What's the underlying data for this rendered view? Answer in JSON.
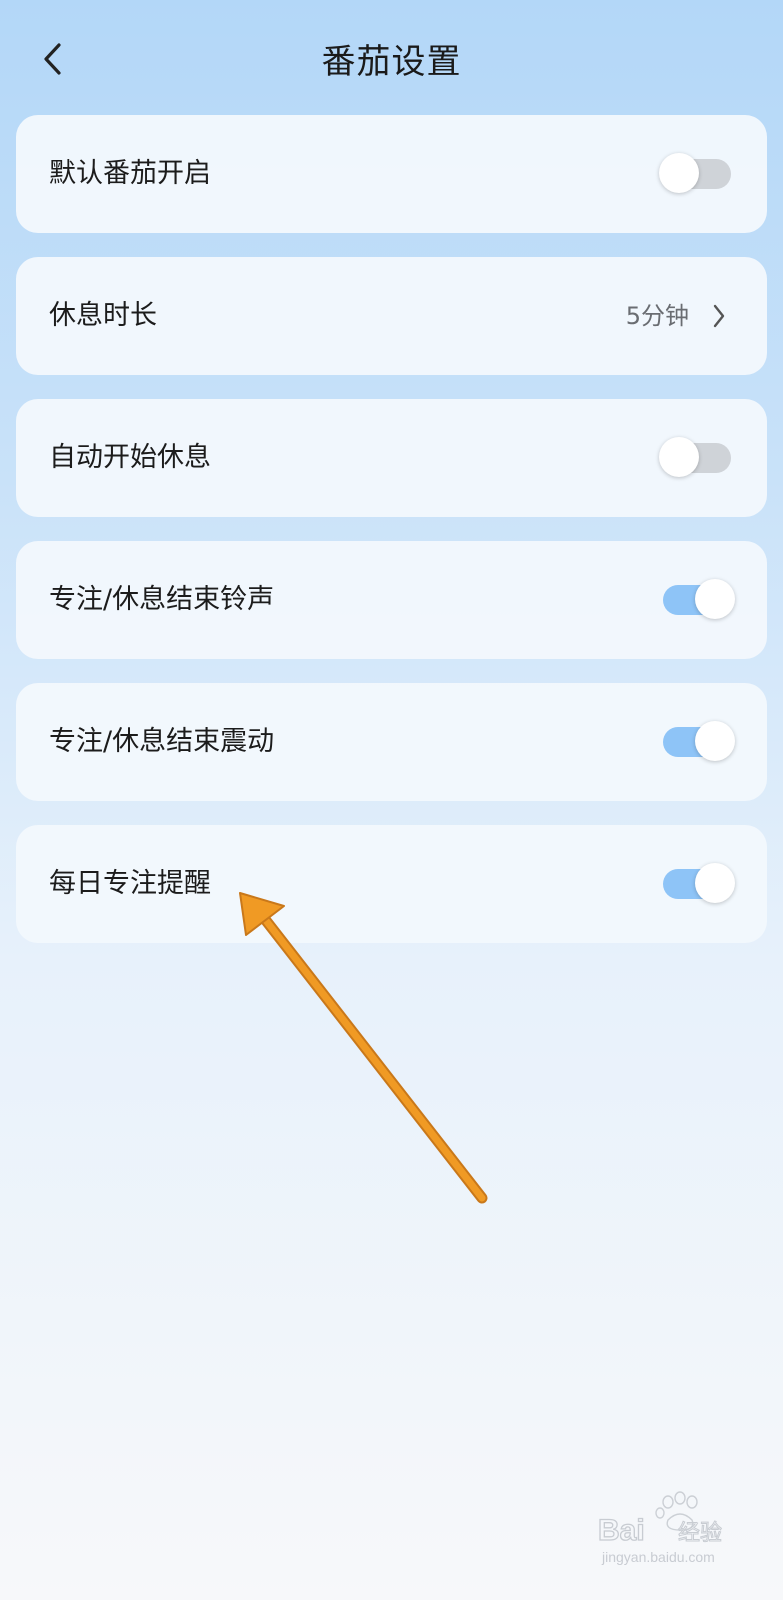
{
  "header": {
    "title": "番茄设置",
    "back_icon": "chevron-left-icon"
  },
  "settings": [
    {
      "label": "默认番茄开启",
      "control": "toggle",
      "on": false
    },
    {
      "label": "休息时长",
      "control": "value",
      "value": "5分钟",
      "icon": "chevron-right-icon"
    },
    {
      "label": "自动开始休息",
      "control": "toggle",
      "on": false
    },
    {
      "label": "专注/休息结束铃声",
      "control": "toggle",
      "on": true
    },
    {
      "label": "专注/休息结束震动",
      "control": "toggle",
      "on": true
    },
    {
      "label": "每日专注提醒",
      "control": "toggle",
      "on": true
    }
  ],
  "colors": {
    "toggle_on": "#8ec4f7",
    "toggle_off": "#cfd3d8",
    "annotation_arrow": "#f09a24"
  },
  "annotation": {
    "icon": "orange-arrow-icon"
  },
  "watermark": {
    "brand": "Baidu经验",
    "url": "jingyan.baidu.com"
  }
}
